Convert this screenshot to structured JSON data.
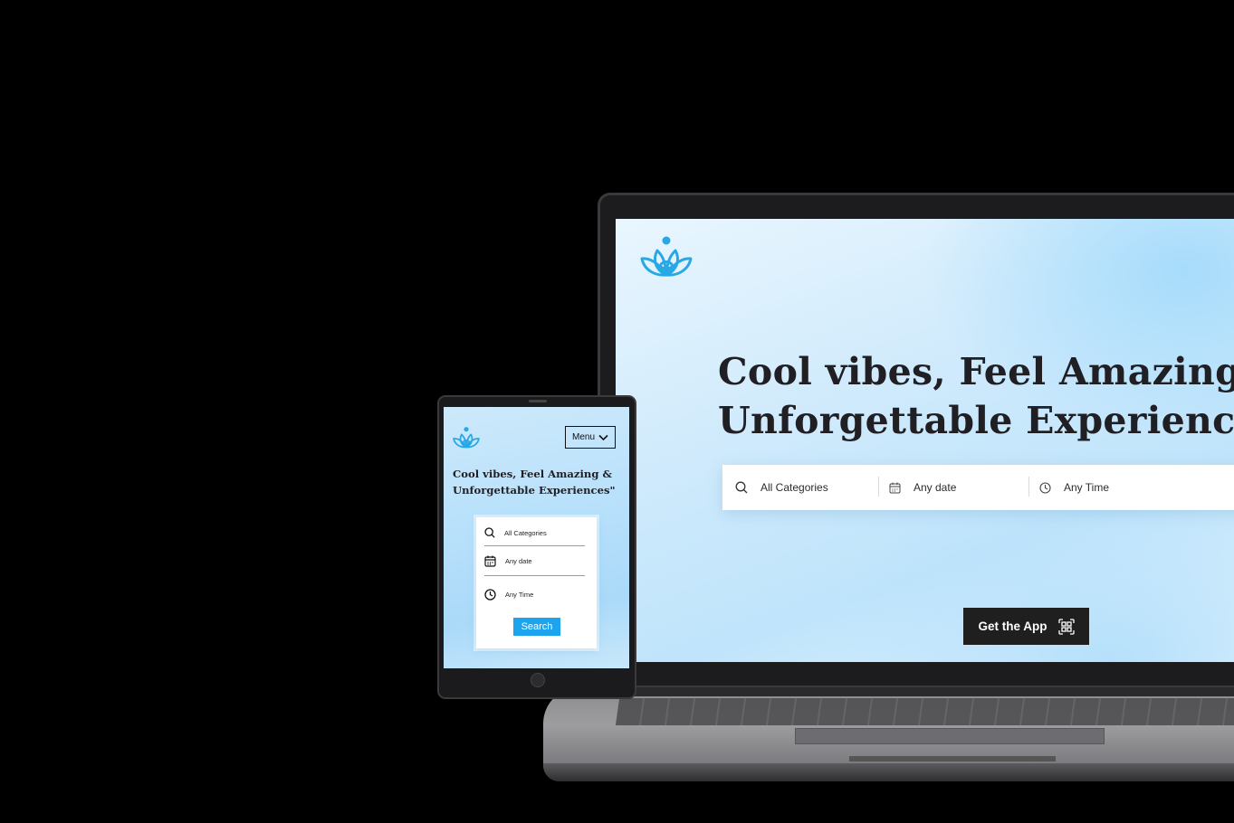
{
  "colors": {
    "background": "#000000",
    "accent_blue": "#1da4ee",
    "logo_blue": "#29a8e6",
    "button_dark": "#1f1f1f",
    "headline_text": "#1f1f24"
  },
  "laptop": {
    "logo_icon": "lotus-logo-icon",
    "headline_line1": "Cool vibes, Feel Amazing &",
    "headline_line2": "Unforgettable Experiences\"",
    "search": {
      "category": {
        "icon": "search-icon",
        "label": "All Categories"
      },
      "date": {
        "icon": "calendar-icon",
        "label": "Any date"
      },
      "time": {
        "icon": "clock-icon",
        "label": "Any Time"
      }
    },
    "get_app": {
      "label": "Get the App",
      "icon": "qr-code-icon"
    }
  },
  "tablet": {
    "logo_icon": "lotus-logo-icon",
    "menu_label": "Menu",
    "menu_icon": "chevron-down-icon",
    "headline_line1": "Cool vibes, Feel Amazing &",
    "headline_line2": "Unforgettable Experiences\"",
    "search": {
      "category": {
        "icon": "search-icon",
        "label": "All Categories"
      },
      "date": {
        "icon": "calendar-icon",
        "label": "Any date"
      },
      "time": {
        "icon": "clock-icon",
        "label": "Any Time"
      },
      "button_label": "Search"
    }
  }
}
